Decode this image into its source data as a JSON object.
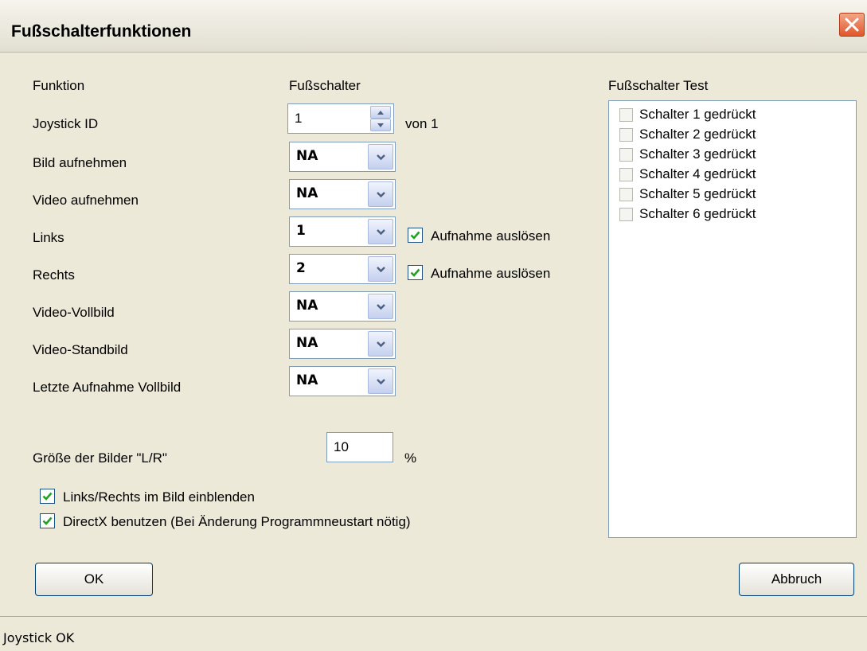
{
  "window": {
    "title": "Fußschalterfunktionen"
  },
  "headers": {
    "funktion": "Funktion",
    "fussschalter": "Fußschalter",
    "test": "Fußschalter Test"
  },
  "joystick": {
    "label": "Joystick ID",
    "value": "1",
    "suffix": "von 1"
  },
  "functions": [
    {
      "label": "Bild aufnehmen",
      "value": "NA"
    },
    {
      "label": "Video aufnehmen",
      "value": "NA"
    },
    {
      "label": "Links",
      "value": "1",
      "trigger_label": "Aufnahme auslösen",
      "trigger_checked": true
    },
    {
      "label": "Rechts",
      "value": "2",
      "trigger_label": "Aufnahme auslösen",
      "trigger_checked": true
    },
    {
      "label": "Video-Vollbild",
      "value": "NA"
    },
    {
      "label": "Video-Standbild",
      "value": "NA"
    },
    {
      "label": "Letzte Aufnahme Vollbild",
      "value": "NA"
    }
  ],
  "size": {
    "label": "Größe der Bilder \"L/R\"",
    "value": "10",
    "unit": "%"
  },
  "options": [
    {
      "label": "Links/Rechts im Bild einblenden",
      "checked": true
    },
    {
      "label": "DirectX benutzen (Bei Änderung Programmneustart nötig)",
      "checked": true
    }
  ],
  "switch_test": [
    {
      "label": "Schalter 1 gedrückt",
      "checked": false
    },
    {
      "label": "Schalter 2 gedrückt",
      "checked": false
    },
    {
      "label": "Schalter 3 gedrückt",
      "checked": false
    },
    {
      "label": "Schalter 4 gedrückt",
      "checked": false
    },
    {
      "label": "Schalter 5 gedrückt",
      "checked": false
    },
    {
      "label": "Schalter 6 gedrückt",
      "checked": false
    }
  ],
  "buttons": {
    "ok": "OK",
    "cancel": "Abbruch"
  },
  "status": "Joystick OK",
  "colors": {
    "checkmark": "#21a121",
    "close_button": "#e0562c"
  },
  "icons": {
    "close": "close-icon",
    "dropdown": "chevron-down-icon",
    "spin_up": "spin-up-icon",
    "spin_down": "spin-down-icon",
    "check": "check-icon"
  }
}
